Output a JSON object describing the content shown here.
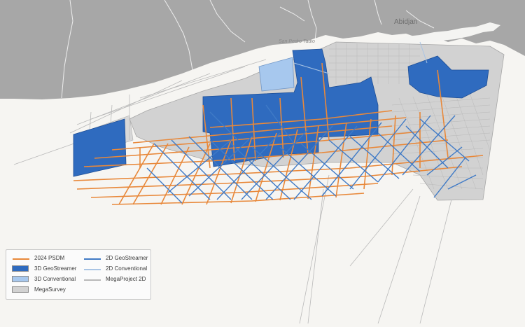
{
  "places": {
    "city_abidjan": "Abidjan",
    "city_sassandra": "San Pedro Tadio"
  },
  "colors": {
    "land": "#a7a7a7",
    "sea": "#f6f5f2",
    "megasurvey": "#d2d2d2",
    "psdm_2024": "#e8883a",
    "geostreamer_3d": "#2f6bbf",
    "conventional_3d": "#a7c8ee",
    "geostreamer_2d": "#3f7ac6",
    "conventional_2d": "#a9c4e4",
    "megaproject_2d": "#b9b9b9"
  },
  "legend": {
    "items": [
      {
        "label": "2024 PSDM",
        "symbol": "line",
        "color": "#e8883a"
      },
      {
        "label": "3D GeoStreamer",
        "symbol": "fill",
        "color": "#2f6bbf"
      },
      {
        "label": "3D Conventional",
        "symbol": "fill",
        "color": "#a7c8ee"
      },
      {
        "label": "MegaSurvey",
        "symbol": "fill",
        "color": "#d2d2d2"
      },
      {
        "label": "2D GeoStreamer",
        "symbol": "line",
        "color": "#3f7ac6"
      },
      {
        "label": "2D Conventional",
        "symbol": "line",
        "color": "#a9c4e4"
      },
      {
        "label": "MegaProject 2D",
        "symbol": "line",
        "color": "#b9b9b9"
      }
    ]
  }
}
